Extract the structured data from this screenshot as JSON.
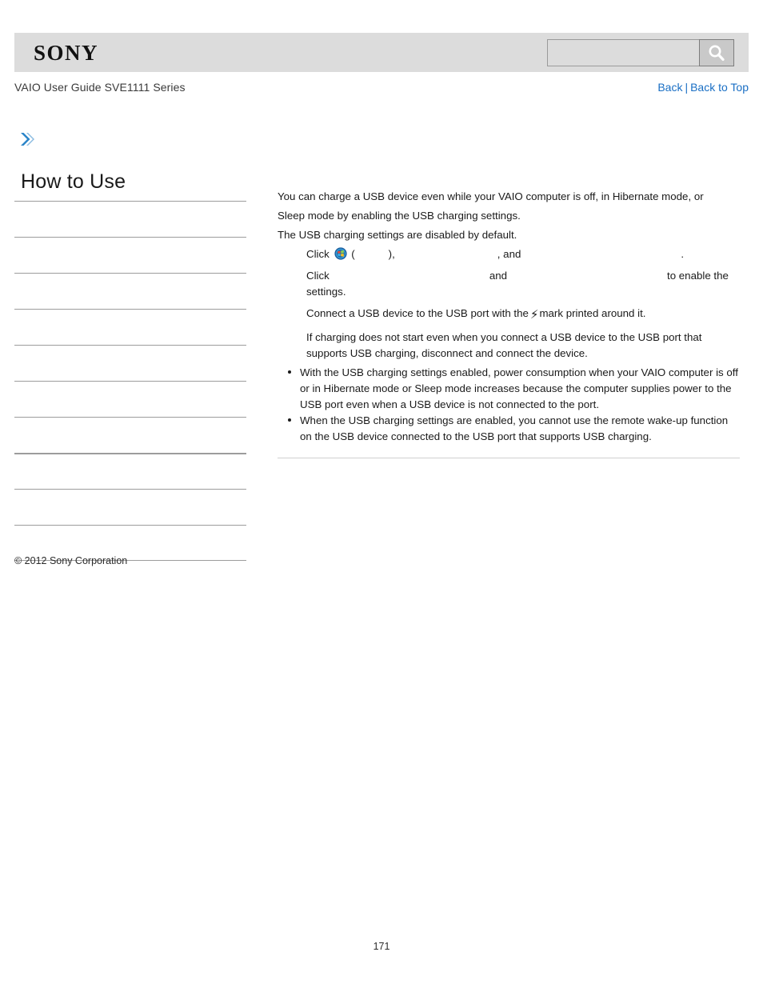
{
  "header": {
    "logo": "SONY",
    "search": {
      "value": "",
      "placeholder": "",
      "icon": "search-icon"
    }
  },
  "titlebar": {
    "doc_title": "VAIO User Guide SVE1111 Series",
    "back_label": "Back",
    "separator": "|",
    "back_to_top_label": "Back to Top",
    "link_color": "#1a6fc4"
  },
  "sidebar": {
    "arrow_icon": "chevron-right-icon",
    "title": "How to Use",
    "items": [
      {
        "label": ""
      },
      {
        "label": ""
      },
      {
        "label": ""
      },
      {
        "label": ""
      },
      {
        "label": ""
      },
      {
        "label": ""
      },
      {
        "label": ""
      },
      {
        "label": ""
      },
      {
        "label": ""
      },
      {
        "label": ""
      }
    ],
    "copyright": "© 2012 Sony Corporation"
  },
  "content": {
    "intro_line_1": "You can charge a USB device even while your VAIO computer is off, in Hibernate mode, or",
    "intro_line_2": "Sleep mode by enabling the USB charging settings.",
    "intro_line_3": "The USB charging settings are disabled by default.",
    "step1": {
      "prefix": "Click",
      "orb_icon": "windows-start-orb-icon",
      "open_paren": "(",
      "close_paren": "),",
      "comma_and": ", and",
      "period": "."
    },
    "step2": {
      "prefix": "Click",
      "middle": "and",
      "suffix": "to enable the settings."
    },
    "step3": {
      "before_bolt": "Connect a USB device to the USB port with the",
      "bolt_icon": "lightning-bolt-icon",
      "after_bolt": "mark printed around it."
    },
    "step4_line_1": "If charging does not start even when you connect a USB device to the USB port that",
    "step4_line_2": "supports USB charging, disconnect and connect the device."
  },
  "notes": {
    "items": [
      "With the USB charging settings enabled, power consumption when your VAIO computer is off or in Hibernate mode or Sleep mode increases because the computer supplies power to the USB port even when a USB device is not connected to the port.",
      "When the USB charging settings are enabled, you cannot use the remote wake-up function on the USB device connected to the USB port that supports USB charging."
    ]
  },
  "footer": {
    "page_number": "171"
  }
}
